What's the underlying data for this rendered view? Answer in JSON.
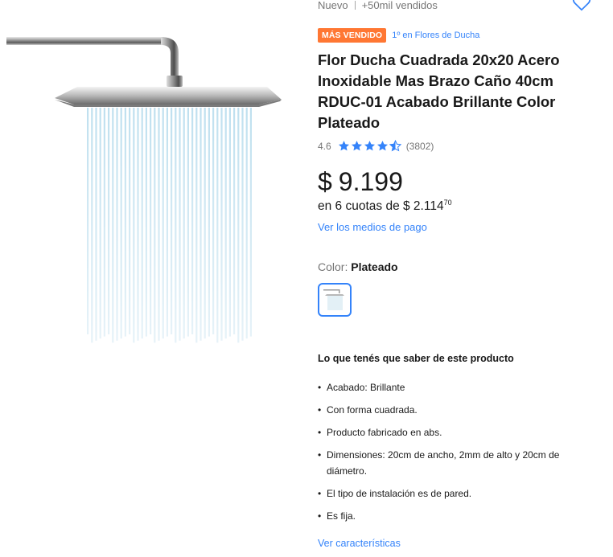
{
  "product": {
    "condition": "Nuevo",
    "sold": "+50mil vendidos",
    "badge": "MÁS VENDIDO",
    "ranking": "1º en Flores de Ducha",
    "title": "Flor Ducha Cuadrada 20x20 Acero Inoxidable Mas Brazo Caño 40cm RDUC-01 Acabado Brillante Color Plateado",
    "rating": "4.6",
    "rating_value": 4.6,
    "reviews": "(3802)",
    "currency": "$",
    "price": "9.199",
    "installments_text": "en 6 cuotas de $ 2.114",
    "installments_cents": "70",
    "payment_link": "Ver los medios de pago",
    "color_label": "Color:",
    "color_value": "Plateado"
  },
  "features": {
    "title": "Lo que tenés que saber de este producto",
    "items": [
      "Acabado: Brillante",
      "Con forma cuadrada.",
      "Producto fabricado en abs.",
      "Dimensiones: 20cm de ancho, 2mm de alto y 20cm de diámetro.",
      "El tipo de instalación es de pared.",
      "Es fija."
    ],
    "link": "Ver características"
  },
  "icons": {
    "favorite": "heart-outline-icon",
    "star": "star-icon",
    "half_star": "star-half-icon"
  },
  "colors": {
    "accent": "#3483fa",
    "badge": "#ff7733"
  }
}
